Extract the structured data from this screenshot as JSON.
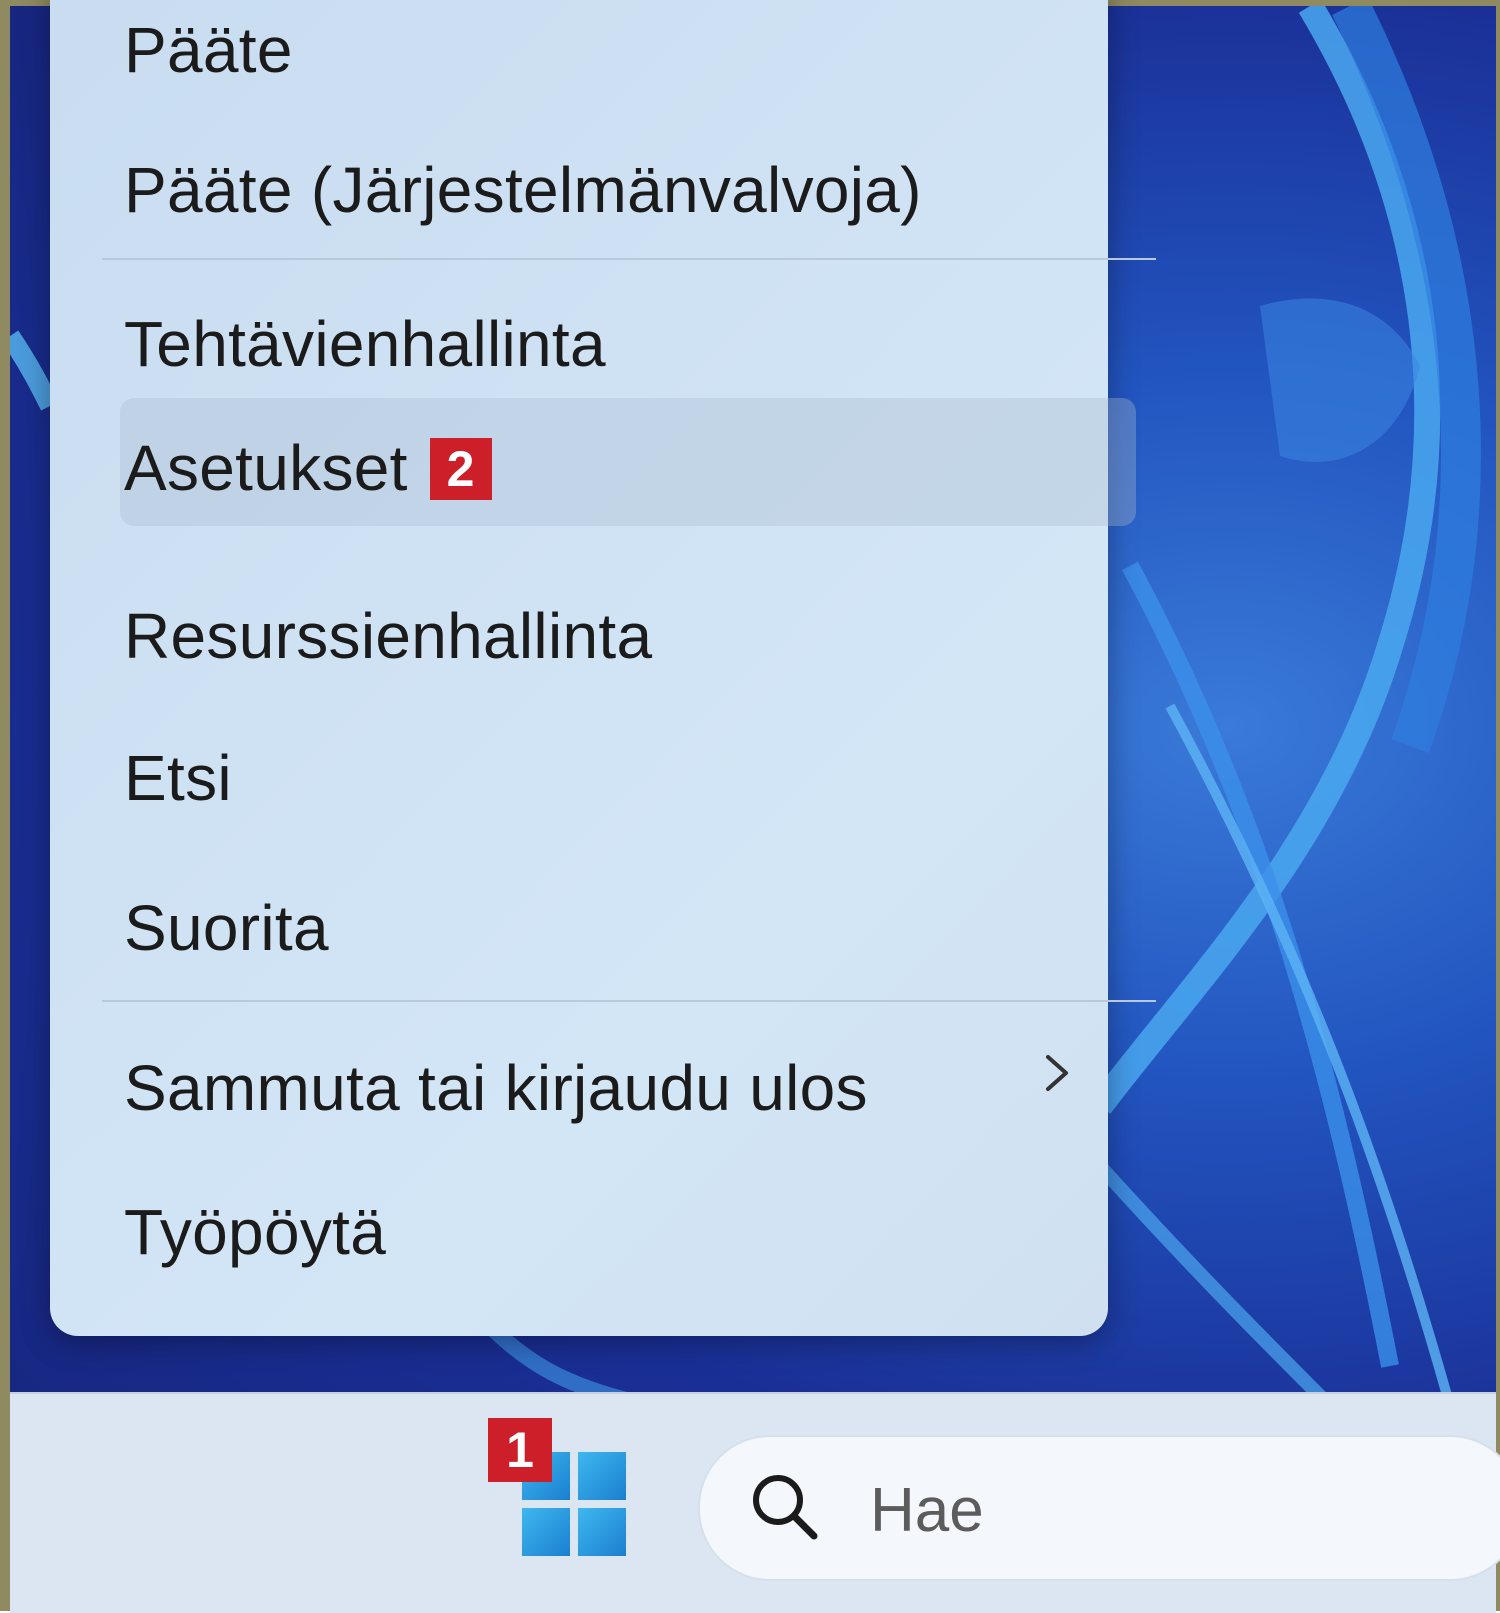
{
  "context_menu": {
    "items": [
      {
        "label": "Pääte"
      },
      {
        "label": "Pääte (Järjestelmänvalvoja)"
      },
      {
        "label": "Tehtävienhallinta"
      },
      {
        "label": "Asetukset",
        "badge": "2"
      },
      {
        "label": "Resurssienhallinta"
      },
      {
        "label": "Etsi"
      },
      {
        "label": "Suorita"
      },
      {
        "label": "Sammuta tai kirjaudu ulos"
      },
      {
        "label": "Työpöytä"
      }
    ],
    "highlighted_item": "Asetukset"
  },
  "taskbar": {
    "start_badge": "1",
    "search": {
      "placeholder": "Hae",
      "icon": "search-icon"
    },
    "start_icon": "windows-logo-icon"
  },
  "colors": {
    "badge": "#cc1f2a",
    "menu_background": "#cfe2f4",
    "desktop_accent": "#1a2f96"
  }
}
